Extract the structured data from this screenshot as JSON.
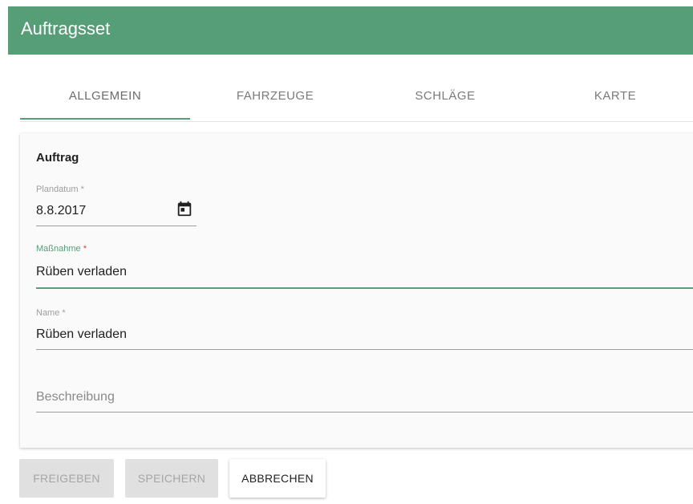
{
  "header": {
    "title": "Auftragsset"
  },
  "tabs": [
    {
      "label": "ALLGEMEIN",
      "active": true
    },
    {
      "label": "FAHRZEUGE",
      "active": false
    },
    {
      "label": "SCHLÄGE",
      "active": false
    },
    {
      "label": "KARTE",
      "active": false
    }
  ],
  "form": {
    "section_title": "Auftrag",
    "plandatum": {
      "label": "Plandatum *",
      "value": "8.8.2017",
      "icon": "calendar-icon"
    },
    "massnahme": {
      "label": "Maßnahme",
      "required_mark": "*",
      "value": "Rüben verladen"
    },
    "name": {
      "label": "Name *",
      "value": "Rüben verladen"
    },
    "beschreibung": {
      "placeholder": "Beschreibung"
    }
  },
  "actions": {
    "freigeben": "FREIGEBEN",
    "speichern": "SPEICHERN",
    "abbrechen": "ABBRECHEN"
  },
  "colors": {
    "accent": "#559e77",
    "required": "#e53935"
  }
}
